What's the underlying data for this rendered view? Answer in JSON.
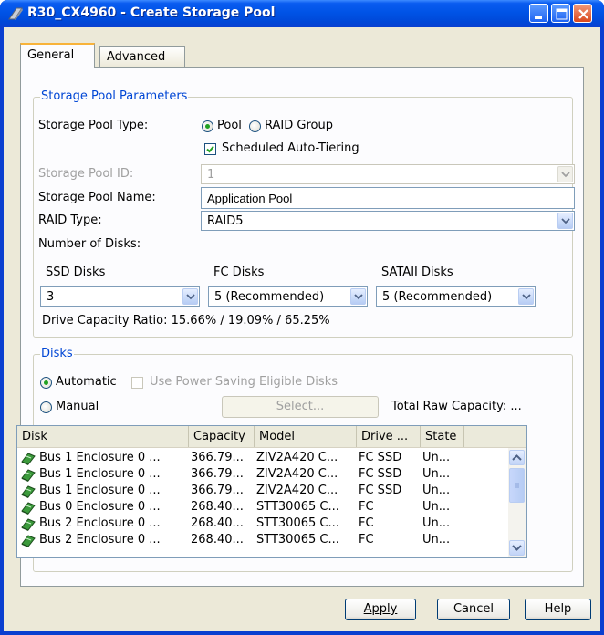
{
  "window": {
    "title": "R30_CX4960 - Create Storage Pool"
  },
  "tabs": [
    {
      "label": "General"
    },
    {
      "label": "Advanced"
    }
  ],
  "params": {
    "legend": "Storage Pool Parameters",
    "pool_type_label": "Storage Pool Type:",
    "pool_option": "Pool",
    "raid_group_option": "RAID Group",
    "auto_tiering_label": "Scheduled Auto-Tiering",
    "pool_id_label": "Storage Pool ID:",
    "pool_id_value": "1",
    "pool_name_label": "Storage Pool Name:",
    "pool_name_value": "Application Pool",
    "raid_type_label": "RAID Type:",
    "raid_type_value": "RAID5",
    "num_disks_label": "Number of Disks:",
    "ssd_label": "SSD Disks",
    "ssd_value": "3",
    "fc_label": "FC Disks",
    "fc_value": "5 (Recommended)",
    "sata_label": "SATAII Disks",
    "sata_value": "5 (Recommended)",
    "capacity_ratio": "Drive Capacity Ratio: 15.66% / 19.09% / 65.25%"
  },
  "disks": {
    "legend": "Disks",
    "automatic_label": "Automatic",
    "power_saving_label": "Use Power Saving Eligible Disks",
    "manual_label": "Manual",
    "select_label": "Select...",
    "total_raw": "Total Raw Capacity: ...",
    "columns": [
      "Disk",
      "Capacity",
      "Model",
      "Drive ...",
      "State"
    ],
    "rows": [
      {
        "disk": "Bus 1 Enclosure 0 ...",
        "capacity": "366.79...",
        "model": "ZIV2A420 C...",
        "drive": "FC SSD",
        "state": "Un..."
      },
      {
        "disk": "Bus 1 Enclosure 0 ...",
        "capacity": "366.79...",
        "model": "ZIV2A420 C...",
        "drive": "FC SSD",
        "state": "Un..."
      },
      {
        "disk": "Bus 1 Enclosure 0 ...",
        "capacity": "366.79...",
        "model": "ZIV2A420 C...",
        "drive": "FC SSD",
        "state": "Un..."
      },
      {
        "disk": "Bus 0 Enclosure 0 ...",
        "capacity": "268.40...",
        "model": "STT30065 C...",
        "drive": "FC",
        "state": "Un..."
      },
      {
        "disk": "Bus 2 Enclosure 0 ...",
        "capacity": "268.40...",
        "model": "STT30065 C...",
        "drive": "FC",
        "state": "Un..."
      },
      {
        "disk": "Bus 2 Enclosure 0 ...",
        "capacity": "268.40...",
        "model": "STT30065 C...",
        "drive": "FC",
        "state": "Un..."
      }
    ]
  },
  "buttons": {
    "apply": "Apply",
    "cancel": "Cancel",
    "help": "Help"
  },
  "icons": {
    "title": "storage-pool-icon",
    "disk": "disk-drive-icon",
    "minimize": "minimize-icon",
    "maximize": "maximize-icon",
    "close": "close-icon"
  },
  "colors": {
    "titlebar": "#0053e6",
    "dialog_bg": "#ece9d8",
    "legend_text": "#0046d5",
    "radio_dot": "#21a121",
    "check_mark": "#21a121"
  }
}
